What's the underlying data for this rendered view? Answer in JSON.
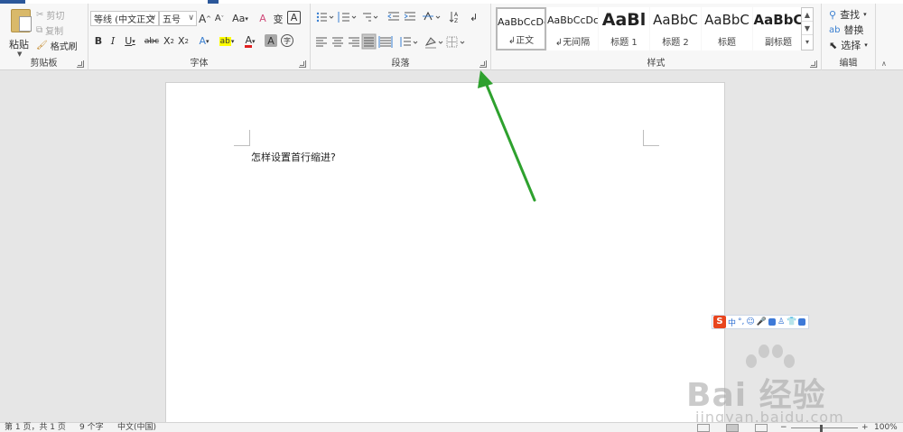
{
  "ribbon": {
    "clipboard": {
      "label": "剪贴板",
      "paste": "粘贴",
      "cut": "剪切",
      "copy": "复制",
      "format_painter": "格式刷"
    },
    "font": {
      "label": "字体",
      "font_name": "等线 (中文正文",
      "font_size": "五号",
      "grow": "A",
      "shrink": "A",
      "change_case": "Aa",
      "clear_format": "A",
      "phonetic": "变",
      "border_char": "A",
      "bold": "B",
      "italic": "I",
      "underline": "U",
      "strike": "abc",
      "subscript": "X",
      "superscript": "X",
      "text_effects": "A",
      "highlight": "ab",
      "font_color": "A",
      "shading": "A",
      "enclose": "字"
    },
    "paragraph": {
      "label": "段落"
    },
    "styles": {
      "label": "样式",
      "items": [
        {
          "preview": "AaBbCcDc",
          "name": "正文"
        },
        {
          "preview": "AaBbCcDc",
          "name": "无间隔"
        },
        {
          "preview": "AaBl",
          "name": "标题 1"
        },
        {
          "preview": "AaBbC",
          "name": "标题 2"
        },
        {
          "preview": "AaBbC",
          "name": "标题"
        },
        {
          "preview": "AaBbC",
          "name": "副标题"
        }
      ]
    },
    "editing": {
      "label": "编辑",
      "find": "查找",
      "replace": "替换",
      "select": "选择"
    }
  },
  "document": {
    "text": "怎样设置首行缩进?"
  },
  "ime": {
    "logo": "S",
    "mode": "中"
  },
  "watermark": {
    "main": "Bai 经验",
    "sub": "jingyan.baidu.com"
  },
  "status": {
    "page": "第 1 页，共 1 页",
    "words": "9 个字",
    "language": "中文(中国)",
    "zoom_minus": "−",
    "zoom_plus": "+",
    "zoom": "100%",
    "zoom_fraction": 0.45
  },
  "colors": {
    "accent": "#2b579a",
    "arrow": "#2ea12e",
    "highlight": "#ffff00",
    "font_color": "#e02020"
  }
}
